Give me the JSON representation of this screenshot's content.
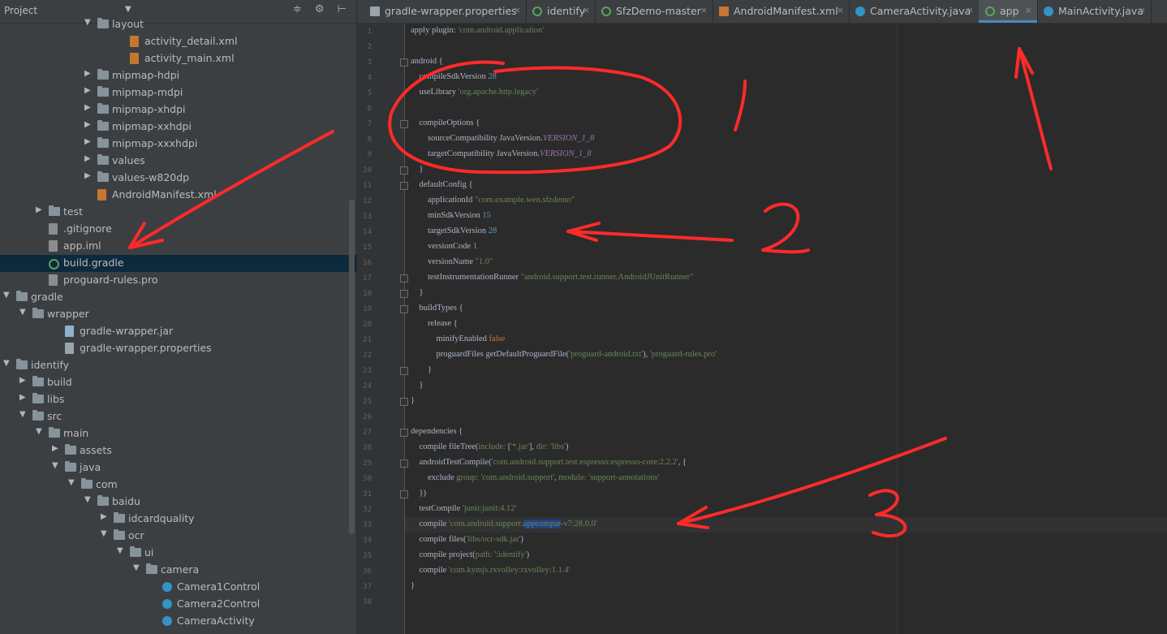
{
  "project_panel": {
    "title": "Project",
    "dropdown_glyph": "▼",
    "tools": "≑ ⚙ ⊢",
    "rows": [
      {
        "label": "layout",
        "indent": 5,
        "arrow": "▼",
        "icon": "folder"
      },
      {
        "label": "activity_detail.xml",
        "indent": 7,
        "arrow": "",
        "icon": "xml"
      },
      {
        "label": "activity_main.xml",
        "indent": 7,
        "arrow": "",
        "icon": "xml"
      },
      {
        "label": "mipmap-hdpi",
        "indent": 5,
        "arrow": "▶",
        "icon": "folder"
      },
      {
        "label": "mipmap-mdpi",
        "indent": 5,
        "arrow": "▶",
        "icon": "folder"
      },
      {
        "label": "mipmap-xhdpi",
        "indent": 5,
        "arrow": "▶",
        "icon": "folder"
      },
      {
        "label": "mipmap-xxhdpi",
        "indent": 5,
        "arrow": "▶",
        "icon": "folder"
      },
      {
        "label": "mipmap-xxxhdpi",
        "indent": 5,
        "arrow": "▶",
        "icon": "folder"
      },
      {
        "label": "values",
        "indent": 5,
        "arrow": "▶",
        "icon": "folder"
      },
      {
        "label": "values-w820dp",
        "indent": 5,
        "arrow": "▶",
        "icon": "folder"
      },
      {
        "label": "AndroidManifest.xml",
        "indent": 5,
        "arrow": "",
        "icon": "xml"
      },
      {
        "label": "test",
        "indent": 2,
        "arrow": "▶",
        "icon": "folder"
      },
      {
        "label": ".gitignore",
        "indent": 2,
        "arrow": "",
        "icon": "plain"
      },
      {
        "label": "app.iml",
        "indent": 2,
        "arrow": "",
        "icon": "plain"
      },
      {
        "label": "build.gradle",
        "indent": 2,
        "arrow": "",
        "icon": "gradle",
        "selected": true
      },
      {
        "label": "proguard-rules.pro",
        "indent": 2,
        "arrow": "",
        "icon": "plain"
      },
      {
        "label": "gradle",
        "indent": 0,
        "arrow": "▼",
        "icon": "folder"
      },
      {
        "label": "wrapper",
        "indent": 1,
        "arrow": "▼",
        "icon": "folder"
      },
      {
        "label": "gradle-wrapper.jar",
        "indent": 3,
        "arrow": "",
        "icon": "jar"
      },
      {
        "label": "gradle-wrapper.properties",
        "indent": 3,
        "arrow": "",
        "icon": "props"
      },
      {
        "label": "identify",
        "indent": 0,
        "arrow": "▼",
        "icon": "folder"
      },
      {
        "label": "build",
        "indent": 1,
        "arrow": "▶",
        "icon": "folder"
      },
      {
        "label": "libs",
        "indent": 1,
        "arrow": "▶",
        "icon": "folder"
      },
      {
        "label": "src",
        "indent": 1,
        "arrow": "▼",
        "icon": "folder"
      },
      {
        "label": "main",
        "indent": 2,
        "arrow": "▼",
        "icon": "folder"
      },
      {
        "label": "assets",
        "indent": 3,
        "arrow": "▶",
        "icon": "folder"
      },
      {
        "label": "java",
        "indent": 3,
        "arrow": "▼",
        "icon": "folder"
      },
      {
        "label": "com",
        "indent": 4,
        "arrow": "▼",
        "icon": "folder"
      },
      {
        "label": "baidu",
        "indent": 5,
        "arrow": "▼",
        "icon": "folder"
      },
      {
        "label": "idcardquality",
        "indent": 6,
        "arrow": "▶",
        "icon": "folder"
      },
      {
        "label": "ocr",
        "indent": 6,
        "arrow": "▼",
        "icon": "folder"
      },
      {
        "label": "ui",
        "indent": 7,
        "arrow": "▼",
        "icon": "folder"
      },
      {
        "label": "camera",
        "indent": 8,
        "arrow": "▼",
        "icon": "folder"
      },
      {
        "label": "Camera1Control",
        "indent": 9,
        "arrow": "",
        "icon": "cls"
      },
      {
        "label": "Camera2Control",
        "indent": 9,
        "arrow": "",
        "icon": "cls"
      },
      {
        "label": "CameraActivity",
        "indent": 9,
        "arrow": "",
        "icon": "cls"
      }
    ]
  },
  "tabs": [
    {
      "label": "gradle-wrapper.properties",
      "icon": "props",
      "icon_color": "#9aa4ab",
      "active": false
    },
    {
      "label": "identify",
      "icon": "gradle",
      "icon_color": "#5aa35a",
      "active": false
    },
    {
      "label": "SfzDemo-master",
      "icon": "gradle",
      "icon_color": "#5aa35a",
      "active": false
    },
    {
      "label": "AndroidManifest.xml",
      "icon": "xml",
      "icon_color": "#c57633",
      "active": false
    },
    {
      "label": "CameraActivity.java",
      "icon": "class",
      "icon_color": "#3592c4",
      "active": false
    },
    {
      "label": "app",
      "icon": "gradle",
      "icon_color": "#5aa35a",
      "active": true
    },
    {
      "label": "MainActivity.java",
      "icon": "class",
      "icon_color": "#3592c4",
      "active": false
    }
  ],
  "tab_close_glyph": "×",
  "editor": {
    "lines": [
      [
        {
          "t": "apply plugin: "
        },
        {
          "t": "'com.android.application'",
          "c": "str"
        }
      ],
      [],
      [
        {
          "t": "android {"
        }
      ],
      [
        {
          "t": "    compileSdkVersion "
        },
        {
          "t": "28",
          "c": "num"
        }
      ],
      [
        {
          "t": "    useLibrary "
        },
        {
          "t": "'org.apache.http.legacy'",
          "c": "str"
        }
      ],
      [],
      [
        {
          "t": "    compileOptions {"
        }
      ],
      [
        {
          "t": "        sourceCompatibility JavaVersion."
        },
        {
          "t": "VERSION_1_8",
          "c": "field"
        }
      ],
      [
        {
          "t": "        targetCompatibility JavaVersion."
        },
        {
          "t": "VERSION_1_8",
          "c": "field"
        }
      ],
      [
        {
          "t": "    }"
        }
      ],
      [
        {
          "t": "    defaultConfig {"
        }
      ],
      [
        {
          "t": "        applicationId "
        },
        {
          "t": "\"com.example.wen.sfzdemo\"",
          "c": "str"
        }
      ],
      [
        {
          "t": "        minSdkVersion "
        },
        {
          "t": "15",
          "c": "num"
        }
      ],
      [
        {
          "t": "        targetSdkVersion "
        },
        {
          "t": "28",
          "c": "num"
        }
      ],
      [
        {
          "t": "        versionCode "
        },
        {
          "t": "1",
          "c": "num"
        }
      ],
      [
        {
          "t": "        versionName "
        },
        {
          "t": "\"1.0\"",
          "c": "str"
        }
      ],
      [
        {
          "t": "        testInstrumentationRunner "
        },
        {
          "t": "\"android.support.test.runner.AndroidJUnitRunner\"",
          "c": "str"
        }
      ],
      [
        {
          "t": "    }"
        }
      ],
      [
        {
          "t": "    buildTypes {"
        }
      ],
      [
        {
          "t": "        release {"
        }
      ],
      [
        {
          "t": "            minifyEnabled "
        },
        {
          "t": "false",
          "c": "kw"
        }
      ],
      [
        {
          "t": "            proguardFiles getDefaultProguardFile("
        },
        {
          "t": "'proguard-android.txt'",
          "c": "str"
        },
        {
          "t": "), "
        },
        {
          "t": "'proguard-rules.pro'",
          "c": "str"
        }
      ],
      [
        {
          "t": "        }"
        }
      ],
      [
        {
          "t": "    }"
        }
      ],
      [
        {
          "t": "}"
        }
      ],
      [],
      [
        {
          "t": "dependencies {"
        }
      ],
      [
        {
          "t": "    compile fileTree("
        },
        {
          "t": "include: ",
          "c": "str"
        },
        {
          "t": "["
        },
        {
          "t": "'*.jar'",
          "c": "str"
        },
        {
          "t": "], "
        },
        {
          "t": "dir: ",
          "c": "str"
        },
        {
          "t": "'libs'",
          "c": "str"
        },
        {
          "t": ")"
        }
      ],
      [
        {
          "t": "    androidTestCompile("
        },
        {
          "t": "'com.android.support.test.espresso:espresso-core:2.2.2'",
          "c": "str"
        },
        {
          "t": ", {"
        }
      ],
      [
        {
          "t": "        exclude "
        },
        {
          "t": "group: 'com.android.support'",
          "c": "str"
        },
        {
          "t": ", "
        },
        {
          "t": "module: 'support-annotations'",
          "c": "str"
        }
      ],
      [
        {
          "t": "    })"
        }
      ],
      [
        {
          "t": "    testCompile "
        },
        {
          "t": "'junit:junit:4.12'",
          "c": "str"
        }
      ],
      [
        {
          "t": "    compile "
        },
        {
          "t": "'com.android.support:",
          "c": "str"
        },
        {
          "t": "appcompat",
          "c": "str sel"
        },
        {
          "t": "-v7:28.0.0'",
          "c": "str"
        }
      ],
      [
        {
          "t": "    compile files("
        },
        {
          "t": "'libs/ocr-sdk.jar'",
          "c": "str"
        },
        {
          "t": ")"
        }
      ],
      [
        {
          "t": "    compile project("
        },
        {
          "t": "path: ':identify'",
          "c": "str"
        },
        {
          "t": ")"
        }
      ],
      [
        {
          "t": "    compile "
        },
        {
          "t": "'com.kymjs.rxvolley:rxvolley:1.1.4'",
          "c": "str"
        }
      ],
      [
        {
          "t": "}"
        }
      ],
      []
    ],
    "highlight_line": 33,
    "fold_lines": [
      3,
      7,
      10,
      11,
      17,
      18,
      19,
      23,
      25,
      27,
      29,
      31
    ]
  },
  "annotations": [
    "1",
    "2",
    "3"
  ],
  "colors": {
    "annotation": "#ff2a2a",
    "selection": "#0d293e",
    "accent": "#4a88c7"
  }
}
